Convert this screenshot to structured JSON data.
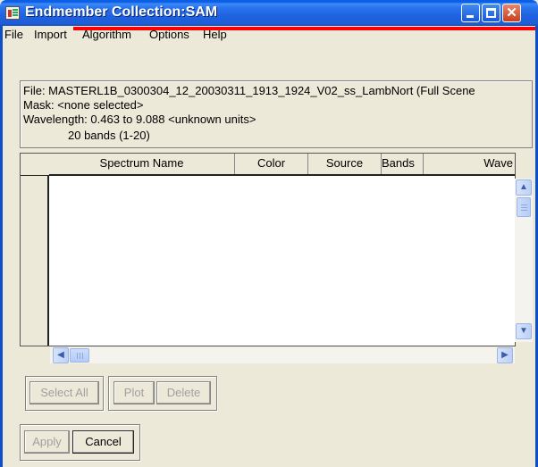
{
  "window": {
    "title": "Endmember Collection:SAM"
  },
  "menu": {
    "items": [
      "File",
      "Import",
      "Algorithm",
      "Options",
      "Help"
    ]
  },
  "info": {
    "file_line": "File: MASTERL1B_0300304_12_20030311_1913_1924_V02_ss_LambNort (Full Scene",
    "mask_line": "Mask: <none selected>",
    "wavelength_line": "Wavelength: 0.463 to 9.088 <unknown units>",
    "bands_line": "20 bands (1-20)"
  },
  "table": {
    "columns": [
      "Spectrum Name",
      "Color",
      "Source",
      "Bands",
      "Wave"
    ],
    "rows": []
  },
  "buttons": {
    "select_all": "Select All",
    "plot": "Plot",
    "delete": "Delete",
    "apply": "Apply",
    "cancel": "Cancel"
  },
  "colors": {
    "titlebar": "#1f62e0",
    "window_bg": "#ece9d8",
    "close_button": "#c5401e",
    "annotation_line": "#ff0000"
  },
  "icons": [
    "app-icon",
    "minimize-icon",
    "maximize-icon",
    "close-icon",
    "scroll-up-icon",
    "scroll-down-icon",
    "scroll-left-icon",
    "scroll-right-icon"
  ]
}
